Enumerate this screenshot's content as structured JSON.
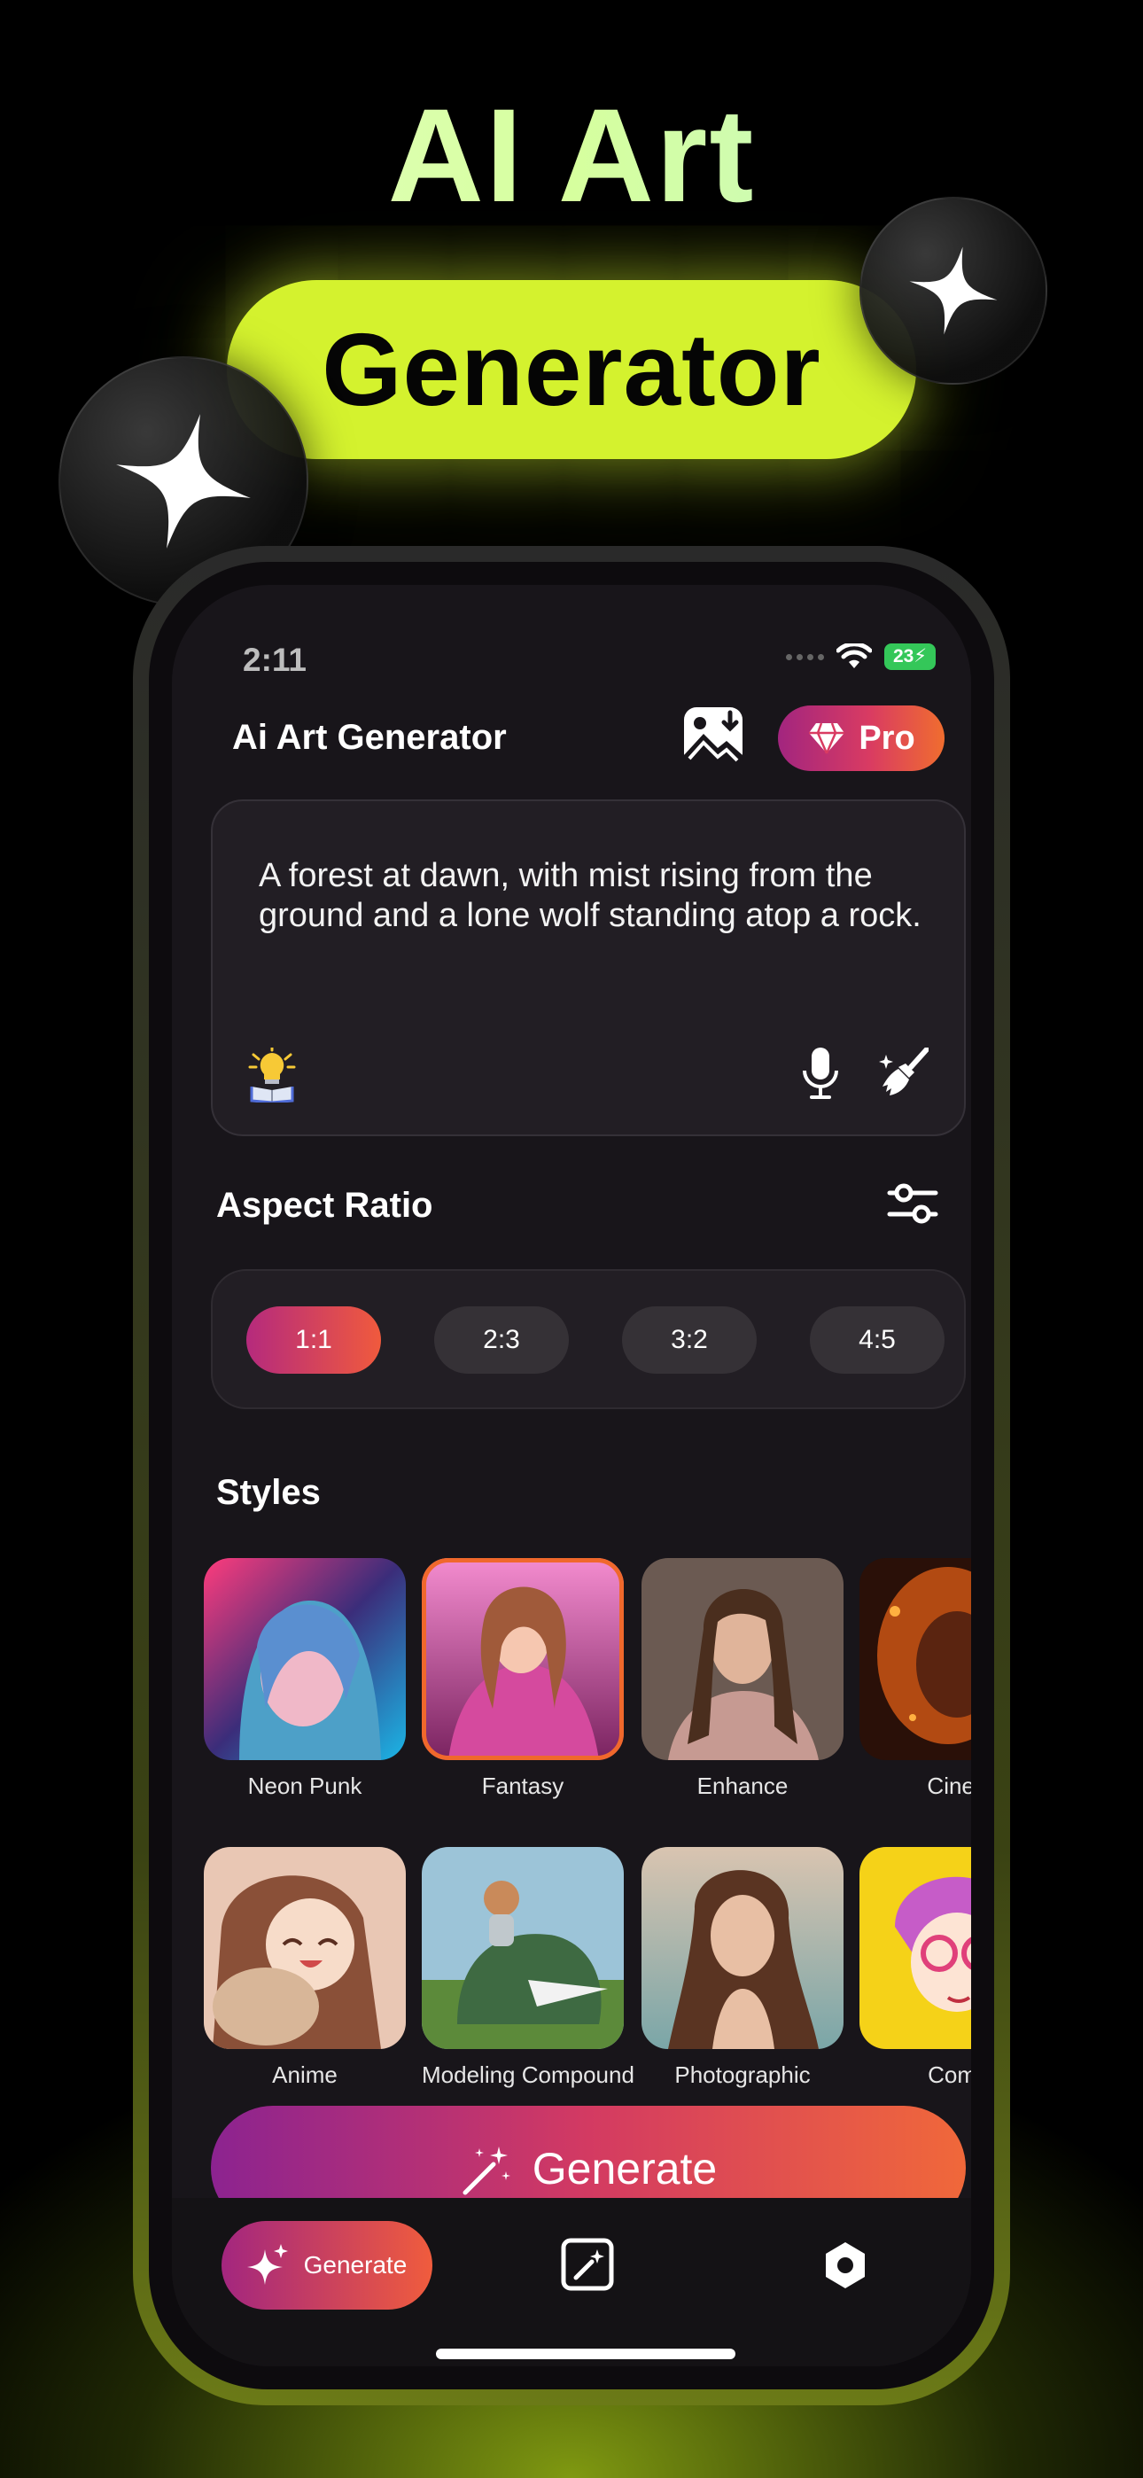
{
  "hero": {
    "title": "AI Art",
    "subtitle": "Generator",
    "icons": [
      "sparkle-star-icon",
      "sparkle-star-icon"
    ]
  },
  "status_bar": {
    "time": "2:11",
    "battery": "23",
    "icons": [
      "signal-dots-icon",
      "wifi-icon",
      "battery-charging-icon"
    ]
  },
  "header": {
    "title": "Ai Art Generator",
    "pro_label": "Pro",
    "icons": [
      "gallery-download-icon",
      "diamond-icon"
    ]
  },
  "prompt": {
    "text": "A forest at dawn, with mist rising from the ground and a lone wolf standing atop a rock.",
    "icons": [
      "idea-bulb-icon",
      "microphone-icon",
      "clear-brush-icon"
    ]
  },
  "aspect_ratio": {
    "title": "Aspect Ratio",
    "options": [
      "1:1",
      "2:3",
      "3:2",
      "4:5"
    ],
    "selected": "1:1"
  },
  "styles": {
    "title": "Styles",
    "row1": [
      {
        "label": "Neon Punk"
      },
      {
        "label": "Fantasy",
        "selected": true
      },
      {
        "label": "Enhance"
      },
      {
        "label": "Cinem"
      }
    ],
    "row2": [
      {
        "label": "Anime"
      },
      {
        "label": "Modeling Compound"
      },
      {
        "label": "Photographic"
      },
      {
        "label": "Comic"
      }
    ]
  },
  "generate_button": {
    "label": "Generate"
  },
  "bottom_nav": {
    "generate_label": "Generate",
    "icons": [
      "sparkles-icon",
      "magic-wand-icon",
      "settings-hexagon-icon"
    ]
  },
  "colors": {
    "accent_lime": "#d4f22e",
    "gradient_start": "#a3267f",
    "gradient_end": "#f06832",
    "background": "#000000"
  }
}
